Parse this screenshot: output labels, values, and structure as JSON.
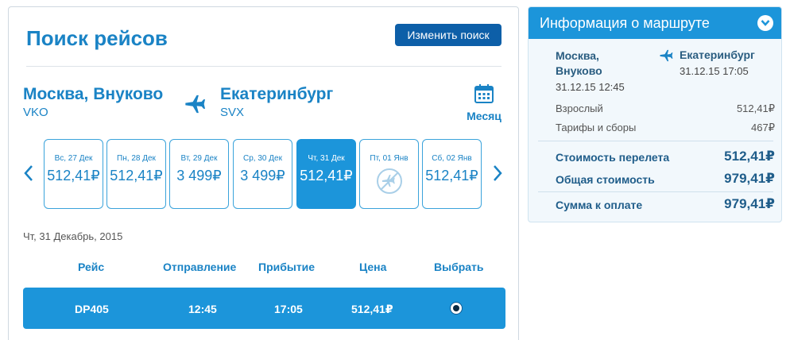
{
  "search": {
    "title": "Поиск рейсов",
    "change_button": "Изменить поиск",
    "from_city": "Москва, Внуково",
    "from_code": "VKO",
    "to_city": "Екатеринбург",
    "to_code": "SVX",
    "month_label": "Месяц"
  },
  "calendar": {
    "days": [
      {
        "date": "Вс, 27 Дек",
        "price": "512,41₽",
        "selected": false,
        "available": true
      },
      {
        "date": "Пн, 28 Дек",
        "price": "512,41₽",
        "selected": false,
        "available": true
      },
      {
        "date": "Вт, 29 Дек",
        "price": "3 499₽",
        "selected": false,
        "available": true
      },
      {
        "date": "Ср, 30 Дек",
        "price": "3 499₽",
        "selected": false,
        "available": true
      },
      {
        "date": "Чт, 31 Дек",
        "price": "512,41₽",
        "selected": true,
        "available": true
      },
      {
        "date": "Пт, 01 Янв",
        "price": "",
        "selected": false,
        "available": false
      },
      {
        "date": "Сб, 02 Янв",
        "price": "512,41₽",
        "selected": false,
        "available": true
      }
    ]
  },
  "results": {
    "date_heading": "Чт, 31 Декабрь, 2015",
    "columns": [
      "Рейс",
      "Отправление",
      "Прибытие",
      "Цена",
      "Выбрать"
    ],
    "rows": [
      {
        "flight": "DP405",
        "departure": "12:45",
        "arrival": "17:05",
        "price": "512,41₽",
        "selected": true
      }
    ]
  },
  "info": {
    "title": "Информация о маршруте",
    "from_city": "Москва,",
    "from_city2": "Внуково",
    "to_city": "Екатеринбург",
    "depart_datetime": "31.12.15 12:45",
    "arrive_datetime": "31.12.15 17:05",
    "adult_label": "Взрослый",
    "adult_value": "512,41₽",
    "taxes_label": "Тарифы и сборы",
    "taxes_value": "467₽",
    "flight_cost_label": "Стоимость перелета",
    "flight_cost_value": "512,41₽",
    "total_label": "Общая стоимость",
    "total_value": "979,41₽",
    "pay_label": "Сумма к оплате",
    "pay_value": "979,41₽"
  },
  "colors": {
    "accent": "#1c95da",
    "title_blue": "#1a83c5",
    "button_dark": "#0d5fa8"
  },
  "icons": [
    "plane-icon",
    "calendar-icon",
    "chevron-left-icon",
    "chevron-right-icon",
    "no-flight-icon",
    "chevron-down-icon"
  ]
}
